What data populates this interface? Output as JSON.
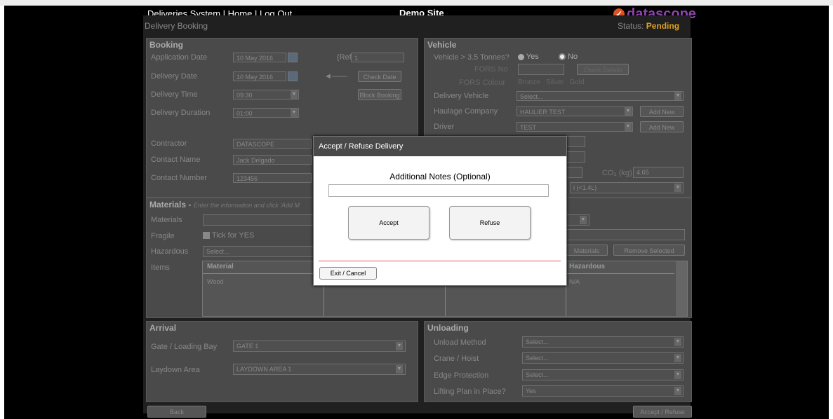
{
  "header": {
    "app_title": "Deliveries System",
    "home_link": "Home",
    "logout_link": "Log Out",
    "site": "Demo Site",
    "logo": "datascope"
  },
  "page": {
    "title": "Delivery Booking",
    "status_label": "Status:",
    "status_value": "Pending"
  },
  "booking": {
    "title": "Booking",
    "application_date_label": "Application Date",
    "application_date": "10 May 2016",
    "ref_label": "(Ref:",
    "ref_value": "1",
    "delivery_date_label": "Delivery Date",
    "delivery_date": "10 May 2016",
    "check_date": "Check Date",
    "delivery_time_label": "Delivery Time",
    "delivery_time": "09:30",
    "block_booking": "Block Booking",
    "delivery_duration_label": "Delivery Duration",
    "delivery_duration": "01:00",
    "contractor_label": "Contractor",
    "contractor": "DATASCOPE",
    "contact_name_label": "Contact Name",
    "contact_name": "Jack Delgado",
    "contact_number_label": "Contact Number",
    "contact_number": "123456"
  },
  "vehicle": {
    "title": "Vehicle",
    "over35_label": "Vehicle > 3.5 Tonnes?",
    "yes": "Yes",
    "no": "No",
    "fors_no_label": "FORS No",
    "check_details": "Check Details",
    "fors_colour_label": "FORS Colour",
    "bronze": "Bronze",
    "silver": "Silver",
    "gold": "Gold",
    "delivery_vehicle_label": "Delivery Vehicle",
    "delivery_vehicle": "Select...",
    "haulage_label": "Haulage Company",
    "haulage": "HAULIER TEST",
    "add_new": "Add New",
    "driver_label": "Driver",
    "driver": "TEST",
    "co2_label": "CO₂ (kg)",
    "co2": "4.65",
    "engine": "l (<1.4L)"
  },
  "materials": {
    "title": "Materials -",
    "hint": "Enter the information and click 'Add M",
    "materials_label": "Materials",
    "fragile_label": "Fragile",
    "tick_yes": "Tick for YES",
    "hazardous_label": "Hazardous",
    "hazardous": "Select...",
    "items_label": "Items",
    "add_materials": "Materials",
    "remove_selected": "Remove Selected",
    "col_material": "Material",
    "col_hazardous": "Hazardous",
    "row_material": "Wood",
    "row_hazardous": "N/A"
  },
  "arrival": {
    "title": "Arrival",
    "gate_label": "Gate / Loading Bay",
    "gate": "GATE 1",
    "laydown_label": "Laydown Area",
    "laydown": "LAYDOWN AREA 1"
  },
  "unloading": {
    "title": "Unloading",
    "method_label": "Unload Method",
    "method": "Select...",
    "crane_label": "Crane / Hoist",
    "crane": "Select...",
    "edge_label": "Edge Protection",
    "edge": "Select...",
    "lifting_label": "Lifting Plan in Place?",
    "lifting": "Yes"
  },
  "footer": {
    "back": "Back",
    "accept_refuse": "Accept / Refuse"
  },
  "modal": {
    "title": "Accept / Refuse Delivery",
    "notes_label": "Additional Notes (Optional)",
    "notes_value": "",
    "accept": "Accept",
    "refuse": "Refuse",
    "exit": "Exit / Cancel"
  }
}
